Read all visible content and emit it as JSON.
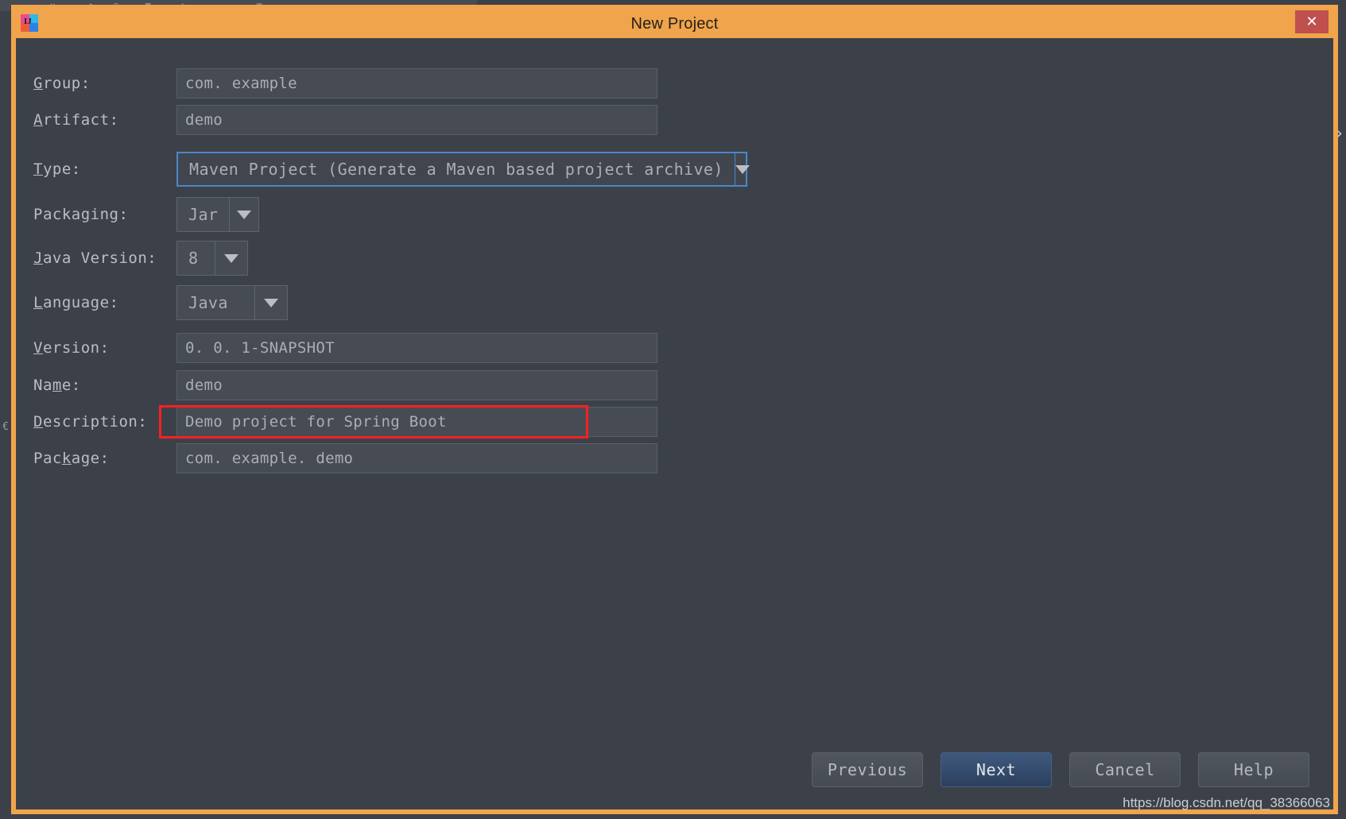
{
  "window": {
    "title": "New Project",
    "close_label": "✕",
    "app_icon": "intellij-idea-icon",
    "accent_color": "#f0a44b",
    "close_color": "#c0504d"
  },
  "form": {
    "rows": [
      {
        "id": "group",
        "label_before": "",
        "label_mnemonic": "G",
        "label_after": "roup:",
        "kind": "text",
        "value": "com. example"
      },
      {
        "id": "artifact",
        "label_before": "",
        "label_mnemonic": "A",
        "label_after": "rtifact:",
        "kind": "text",
        "value": "demo"
      },
      {
        "id": "type",
        "label_before": "",
        "label_mnemonic": "T",
        "label_after": "ype:",
        "kind": "combo",
        "value": "Maven Project (Generate a Maven based project archive)",
        "focused": true
      },
      {
        "id": "packaging",
        "label_before": "Packa",
        "label_mnemonic": "g",
        "label_after": "ing:",
        "kind": "combo",
        "value": "Jar"
      },
      {
        "id": "javaversion",
        "label_before": "",
        "label_mnemonic": "J",
        "label_after": "ava Version:",
        "kind": "combo",
        "value": "8"
      },
      {
        "id": "language",
        "label_before": "",
        "label_mnemonic": "L",
        "label_after": "anguage:",
        "kind": "combo",
        "value": "Java"
      },
      {
        "id": "version",
        "label_before": "",
        "label_mnemonic": "V",
        "label_after": "ersion:",
        "kind": "text",
        "value": "0. 0. 1-SNAPSHOT"
      },
      {
        "id": "name",
        "label_before": "Na",
        "label_mnemonic": "m",
        "label_after": "e:",
        "kind": "text",
        "value": "demo"
      },
      {
        "id": "description",
        "label_before": "",
        "label_mnemonic": "D",
        "label_after": "escription:",
        "kind": "text",
        "value": "Demo project for Spring Boot",
        "annotated": true
      },
      {
        "id": "package",
        "label_before": "Pac",
        "label_mnemonic": "k",
        "label_after": "age:",
        "kind": "text",
        "value": "com. example. demo"
      }
    ]
  },
  "footer": {
    "previous_label": "Previous",
    "next_label": "Next",
    "cancel_label": "Cancel",
    "help_label": "Help"
  },
  "watermark": {
    "text": "https://blog.csdn.net/qq_38366063"
  },
  "annotation": {
    "color": "#ff2020",
    "target": "description-field"
  }
}
